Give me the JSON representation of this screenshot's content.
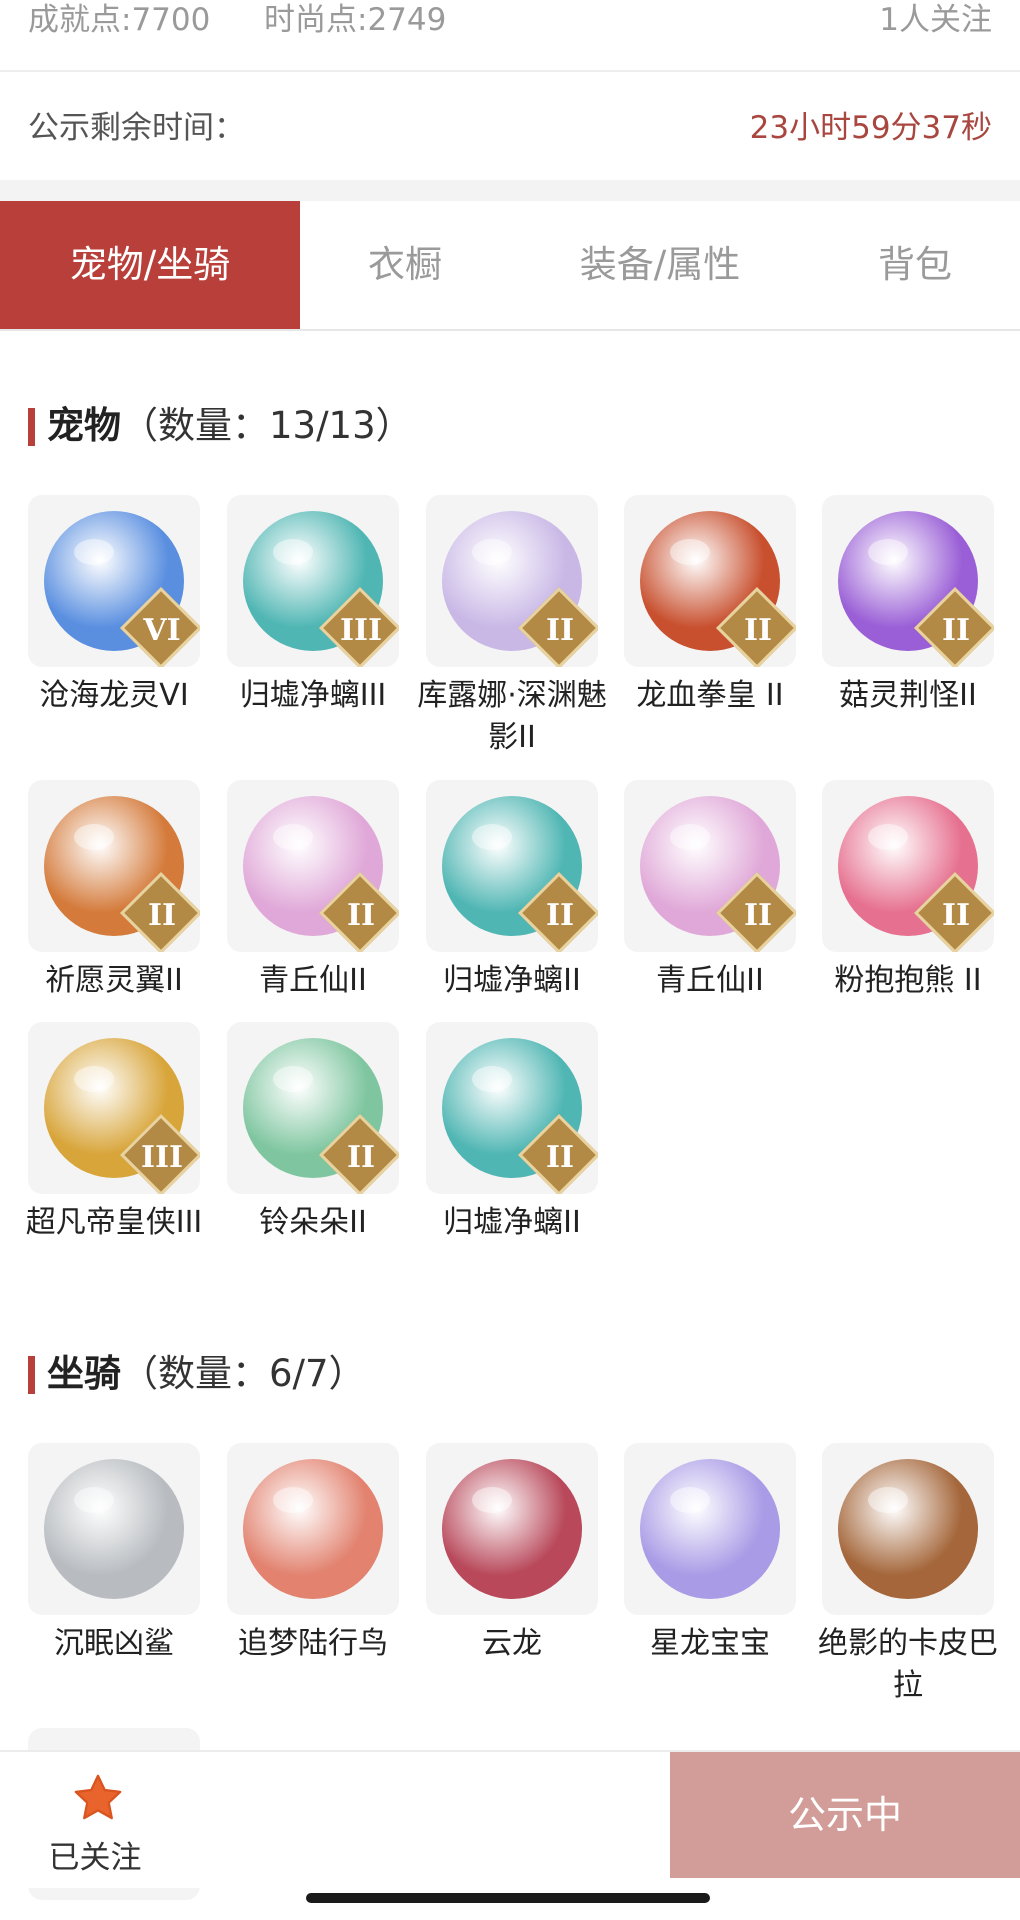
{
  "stats": {
    "achievement": "成就点:7700",
    "fashion": "时尚点:2749",
    "followers": "1人关注"
  },
  "timer": {
    "label": "公示剩余时间：",
    "value": "23小时59分37秒"
  },
  "tabs": [
    {
      "label": "宠物/坐骑",
      "active": true
    },
    {
      "label": "衣橱",
      "active": false
    },
    {
      "label": "装备/属性",
      "active": false
    },
    {
      "label": "背包",
      "active": false
    }
  ],
  "pets_section": {
    "name": "宠物",
    "count": "（数量：13/13）",
    "items": [
      {
        "name": "沧海龙灵VI",
        "badge": "VI",
        "color": "#5a8fe0"
      },
      {
        "name": "归墟净螭III",
        "badge": "III",
        "color": "#4fb6b3"
      },
      {
        "name": "库露娜·深渊魅影II",
        "badge": "II",
        "color": "#c9b8e6"
      },
      {
        "name": "龙血拳皇 II",
        "badge": "II",
        "color": "#c8502f"
      },
      {
        "name": "菇灵荆怪II",
        "badge": "II",
        "color": "#9a5fd6"
      },
      {
        "name": "祈愿灵翼II",
        "badge": "II",
        "color": "#d47a3a"
      },
      {
        "name": "青丘仙II",
        "badge": "II",
        "color": "#e0a8d8"
      },
      {
        "name": "归墟净螭II",
        "badge": "II",
        "color": "#4fb6b3"
      },
      {
        "name": "青丘仙II",
        "badge": "II",
        "color": "#e0a8d8"
      },
      {
        "name": "粉抱抱熊 II",
        "badge": "II",
        "color": "#e6708f"
      },
      {
        "name": "超凡帝皇侠III",
        "badge": "III",
        "color": "#d8a53a"
      },
      {
        "name": "铃朵朵II",
        "badge": "II",
        "color": "#7fc6a0"
      },
      {
        "name": "归墟净螭II",
        "badge": "II",
        "color": "#4fb6b3"
      }
    ]
  },
  "mounts_section": {
    "name": "坐骑",
    "count": "（数量：6/7）",
    "items": [
      {
        "name": "沉眠凶鲨",
        "color": "#b8bcc0"
      },
      {
        "name": "追梦陆行鸟",
        "color": "#e2826f"
      },
      {
        "name": "云龙",
        "color": "#b8485a"
      },
      {
        "name": "星龙宝宝",
        "color": "#a99be6"
      },
      {
        "name": "绝影的卡皮巴拉",
        "color": "#a4663a"
      }
    ]
  },
  "bottom_bar": {
    "follow_label": "已关注",
    "status_label": "公示中"
  }
}
